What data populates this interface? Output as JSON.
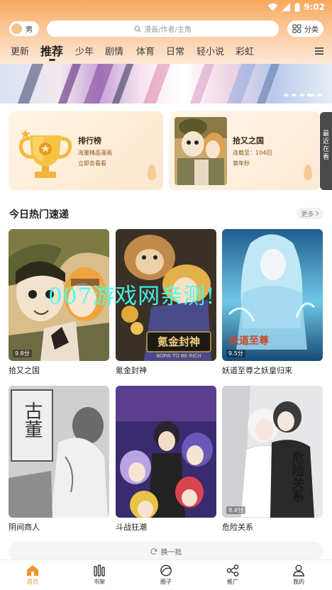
{
  "status_bar": {
    "time": "9:02"
  },
  "toolbar": {
    "gender_label": "男",
    "search_placeholder": "漫画/作者/主角",
    "category_label": "分类"
  },
  "tabs": [
    "更新",
    "推荐",
    "少年",
    "剧情",
    "体育",
    "日常",
    "轻小说",
    "彩虹"
  ],
  "active_tab": "推荐",
  "banner": {
    "page_count": 5,
    "active_index": 3
  },
  "ranking_card": {
    "title": "排行榜",
    "line1": "海量精品漫画",
    "line2": "立即去看看"
  },
  "reading_card": {
    "title": "拾又之国",
    "line1": "连载至：104回",
    "line2": "第年秒"
  },
  "recent_tab": "最近在看",
  "section": {
    "title": "今日热门速递",
    "more_label": "更多"
  },
  "comics": [
    {
      "title": "拾又之国",
      "badge": "9.8分"
    },
    {
      "title": "氪金封神",
      "badge": ""
    },
    {
      "title": "妖道至尊之妖皇归来",
      "badge": "9.5分"
    },
    {
      "title": "阴间商人",
      "badge": ""
    },
    {
      "title": "斗战狂潮",
      "badge": ""
    },
    {
      "title": "危险关系",
      "badge": "9.4分"
    }
  ],
  "cover_texts": {
    "krypton_logo": "氪金封神",
    "krypton_sub": "BORN TO BE RICH",
    "yaodao_logo": "妖道至尊",
    "yinjian_sign": "古董",
    "danger_logo": "危险关系"
  },
  "watermark": "007游戏网亲测!",
  "refresh_label": "换一批",
  "bottom_nav": [
    {
      "label": "首页",
      "icon": "home-icon"
    },
    {
      "label": "书架",
      "icon": "bookshelf-icon"
    },
    {
      "label": "圈子",
      "icon": "circle-icon"
    },
    {
      "label": "推广",
      "icon": "share-icon"
    },
    {
      "label": "我的",
      "icon": "user-icon"
    }
  ],
  "colors": {
    "accent": "#f0952a",
    "header_top": "#f8a85a"
  }
}
